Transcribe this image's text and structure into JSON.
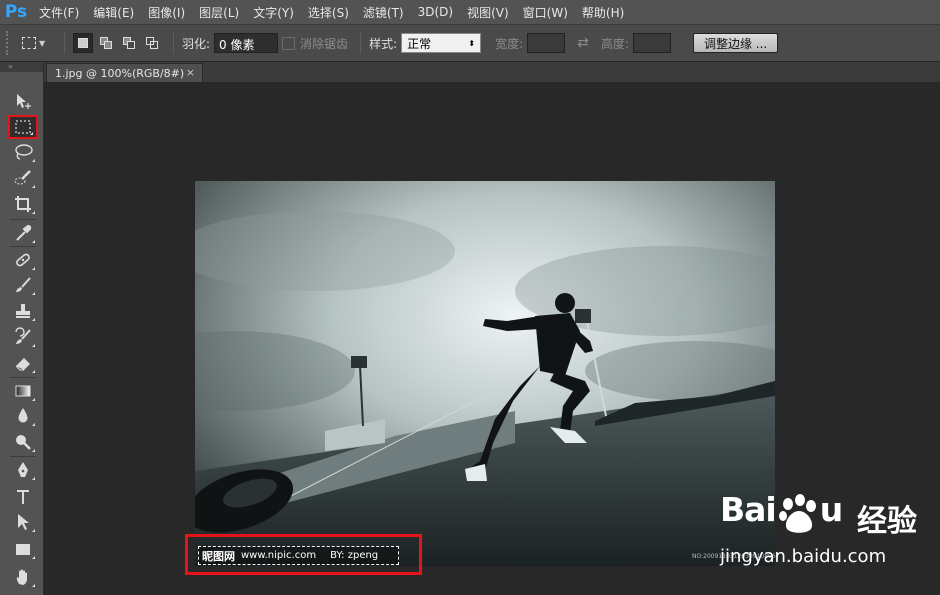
{
  "app": {
    "logo": "Ps"
  },
  "menu": [
    "文件(F)",
    "编辑(E)",
    "图像(I)",
    "图层(L)",
    "文字(Y)",
    "选择(S)",
    "滤镜(T)",
    "3D(D)",
    "视图(V)",
    "窗口(W)",
    "帮助(H)"
  ],
  "options": {
    "feather_label": "羽化:",
    "feather_value": "0 像素",
    "antialias_label": "消除锯齿",
    "style_label": "样式:",
    "style_value": "正常",
    "width_label": "宽度:",
    "height_label": "高度:",
    "refine_edge_button": "调整边缘 ..."
  },
  "document": {
    "tab_title": "1.jpg @ 100%(RGB/8#)",
    "close": "×"
  },
  "watermark": {
    "site_name": "昵图网",
    "url": "www.nipic.com",
    "author": "BY: zpeng",
    "photo_no": "NO:20091103120309108067"
  },
  "overlay": {
    "brand": "Bai",
    "brand_suffix": "u",
    "product": "经验",
    "url": "jingyan.baidu.com"
  },
  "colors": {
    "highlight": "#e6141a",
    "ps_blue": "#31a8ff"
  },
  "tools": [
    "move-tool-icon",
    "rect-marquee-icon",
    "lasso-icon",
    "quick-select-icon",
    "crop-icon",
    "eyedropper-icon",
    "healing-brush-icon",
    "brush-icon",
    "clone-stamp-icon",
    "history-brush-icon",
    "eraser-icon",
    "gradient-icon",
    "blur-icon",
    "dodge-icon",
    "pen-icon",
    "type-icon",
    "path-select-icon",
    "shape-icon",
    "hand-icon"
  ]
}
